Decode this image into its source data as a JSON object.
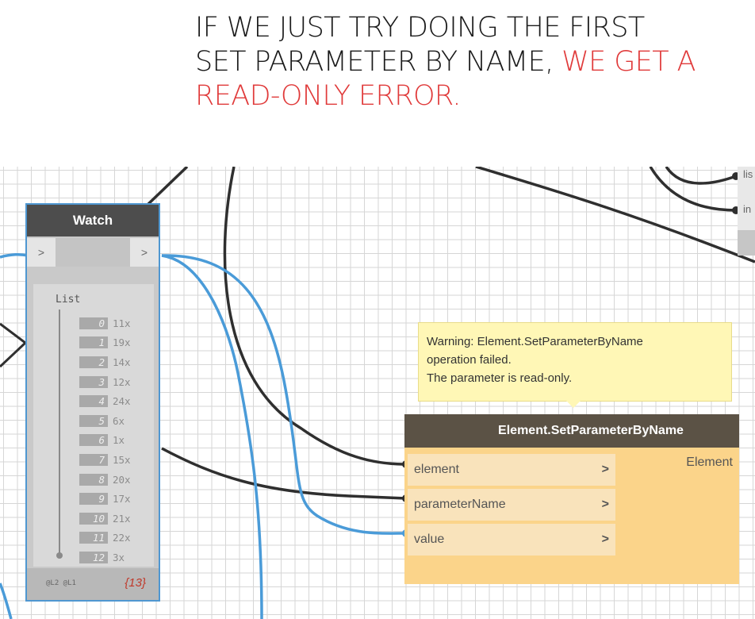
{
  "headline": {
    "line1": "IF WE JUST TRY DOING THE FIRST",
    "line2_dark": "SET PARAMETER BY NAME,",
    "line2_red": " WE GET A",
    "line3_red": "READ-ONLY ERROR.",
    "accent_color": "#e03a3a"
  },
  "watch": {
    "title": "Watch",
    "in_port": ">",
    "out_port": ">",
    "list_label": "List",
    "items": [
      {
        "idx": "0",
        "val": "11x"
      },
      {
        "idx": "1",
        "val": "19x"
      },
      {
        "idx": "2",
        "val": "14x"
      },
      {
        "idx": "3",
        "val": "12x"
      },
      {
        "idx": "4",
        "val": "24x"
      },
      {
        "idx": "5",
        "val": "6x"
      },
      {
        "idx": "6",
        "val": "1x"
      },
      {
        "idx": "7",
        "val": "15x"
      },
      {
        "idx": "8",
        "val": "20x"
      },
      {
        "idx": "9",
        "val": "17x"
      },
      {
        "idx": "10",
        "val": "21x"
      },
      {
        "idx": "11",
        "val": "22x"
      },
      {
        "idx": "12",
        "val": "3x"
      }
    ],
    "levels": "@L2 @L1",
    "count": "{13}"
  },
  "top_node": {
    "port1": "lis",
    "port2": "in"
  },
  "set_param_node": {
    "title": "Element.SetParameterByName",
    "inputs": [
      {
        "label": "element",
        "arrow": ">"
      },
      {
        "label": "parameterName",
        "arrow": ">"
      },
      {
        "label": "value",
        "arrow": ">"
      }
    ],
    "output": "Element",
    "warning_lines": [
      "Warning: Element.SetParameterByName",
      "operation failed.",
      "The parameter is read-only."
    ],
    "colors": {
      "header": "#5b5245",
      "body": "#fbd48a",
      "wire_blue": "#4a9bd8",
      "wire_dark": "#2f2f2f"
    }
  }
}
